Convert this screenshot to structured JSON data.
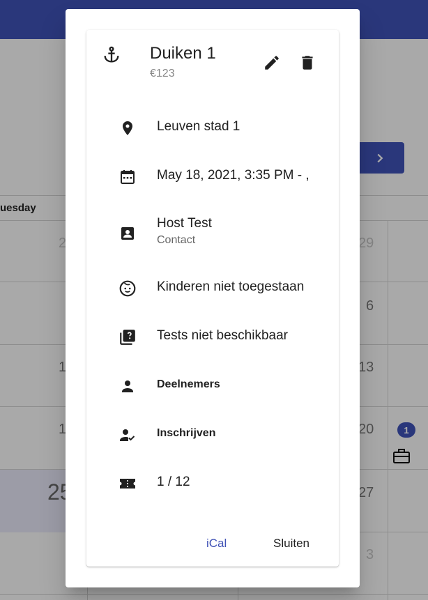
{
  "background": {
    "day_header": "uesday",
    "badge_count": "1",
    "cells": [
      {
        "text": "2",
        "row": 0
      },
      {
        "text": "29",
        "row": 0
      },
      {
        "text": "6",
        "row": 1
      },
      {
        "text": "1",
        "row": 2
      },
      {
        "text": "13",
        "row": 2
      },
      {
        "text": "1",
        "row": 3
      },
      {
        "text": "20",
        "row": 3
      },
      {
        "text": "27",
        "row": 4
      },
      {
        "text": "3",
        "row": 5
      }
    ],
    "today_num": "25",
    "colors": {
      "primary": "#3f51b5",
      "today_bg": "#e6e6f6"
    }
  },
  "dialog": {
    "title": "Duiken 1",
    "price": "€123",
    "header_icon": "anchor-icon",
    "edit_icon": "pencil-icon",
    "delete_icon": "trash-icon",
    "location": "Leuven stad 1",
    "datetime": "May 18, 2021, 3:35 PM - ,",
    "host": "Host Test",
    "host_sub": "Contact",
    "children": "Kinderen niet toegestaan",
    "tests": "Tests niet beschikbaar",
    "participants_button": "Deelnemers",
    "register_button": "Inschrijven",
    "tickets": "1 / 12",
    "ical_button": "iCal",
    "close_button": "Sluiten"
  }
}
